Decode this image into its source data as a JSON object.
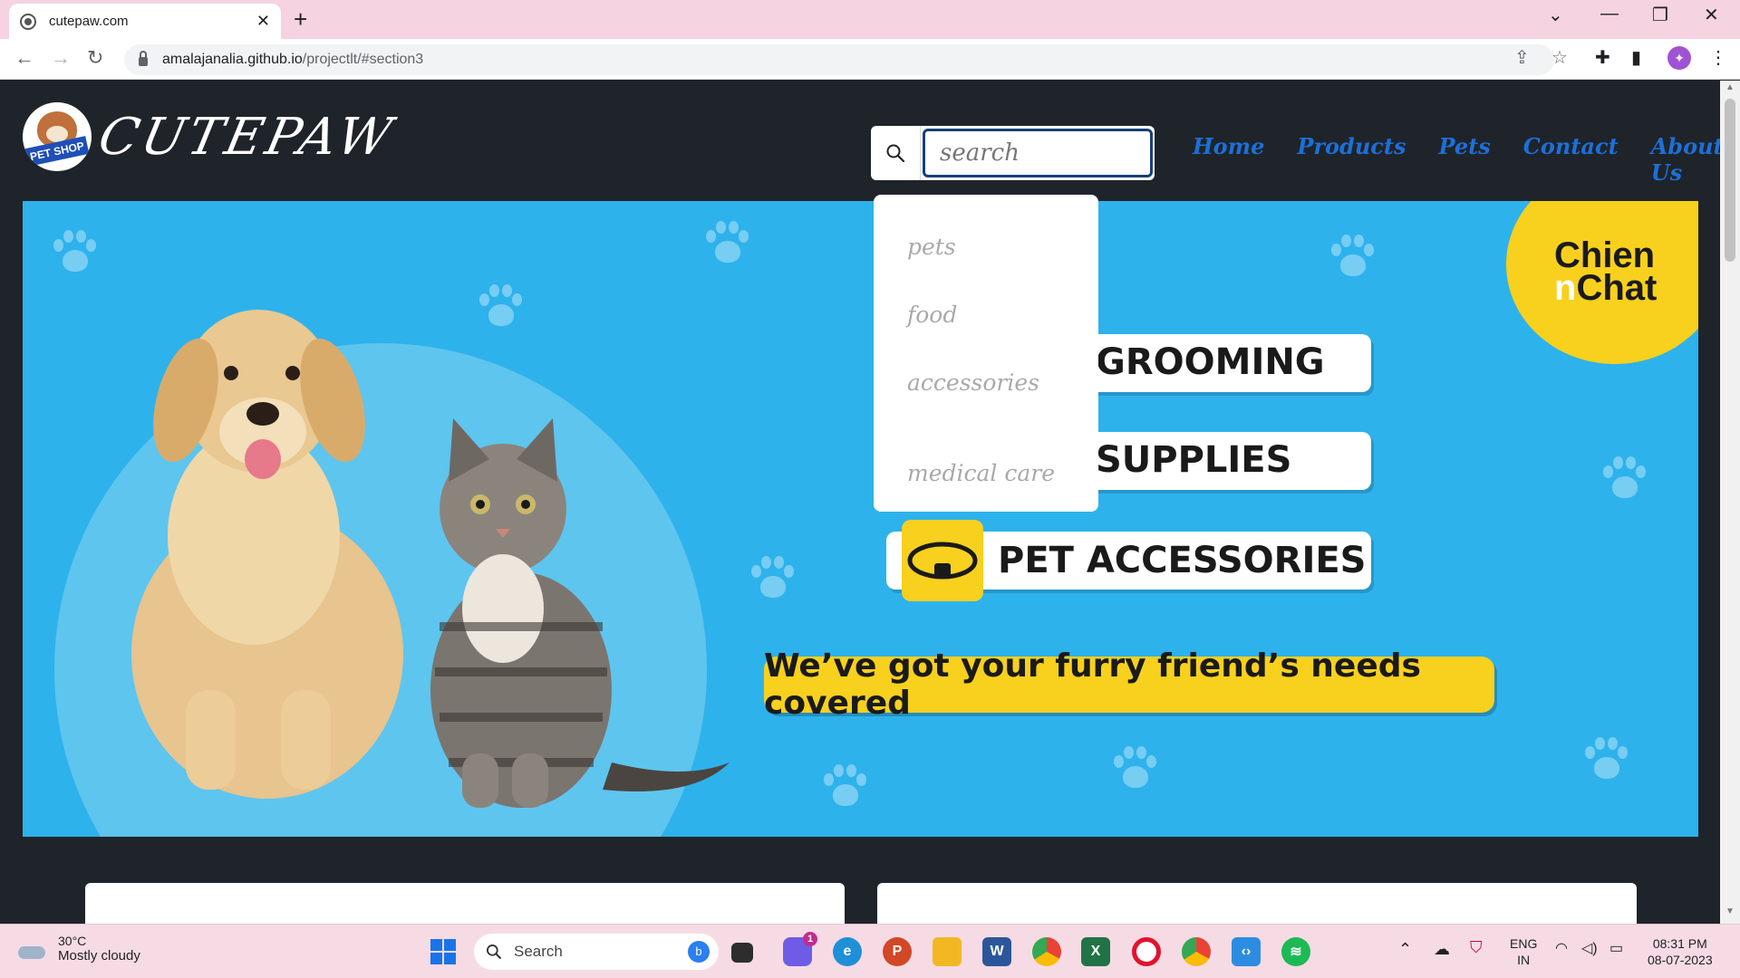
{
  "browser": {
    "tab_title": "cutepaw.com",
    "url_host": "amalajanalia.github.io",
    "url_path": "/projectlt/#section3",
    "profile_initial": "✦"
  },
  "site": {
    "logo_badge_text": "PET SHOP",
    "brand": "CUTEPAW",
    "search_placeholder": "search",
    "nav": [
      "Home",
      "Products",
      "Pets",
      "Contact",
      "About-Us"
    ],
    "dropdown": [
      "pets",
      "food",
      "accessories",
      "medical care"
    ]
  },
  "banner": {
    "corner_brand_line1": "Chien",
    "corner_brand_n": "n",
    "corner_brand_line2": "Chat",
    "pills": [
      "GROOMING",
      "SUPPLIES",
      "PET ACCESSORIES"
    ],
    "tagline": "We’ve got your furry friend’s needs covered"
  },
  "taskbar": {
    "temperature": "30°C",
    "weather": "Mostly cloudy",
    "search_label": "Search",
    "chat_badge": "1",
    "lang_line1": "ENG",
    "lang_line2": "IN",
    "time": "08:31 PM",
    "date": "08-07-2023"
  },
  "colors": {
    "page_bg": "#1f242a",
    "nav_link": "#1d6fd8",
    "banner_bg": "#2eb2ec",
    "brand_yellow": "#f8d01e",
    "tabbar_bg": "#f6d3e1"
  }
}
